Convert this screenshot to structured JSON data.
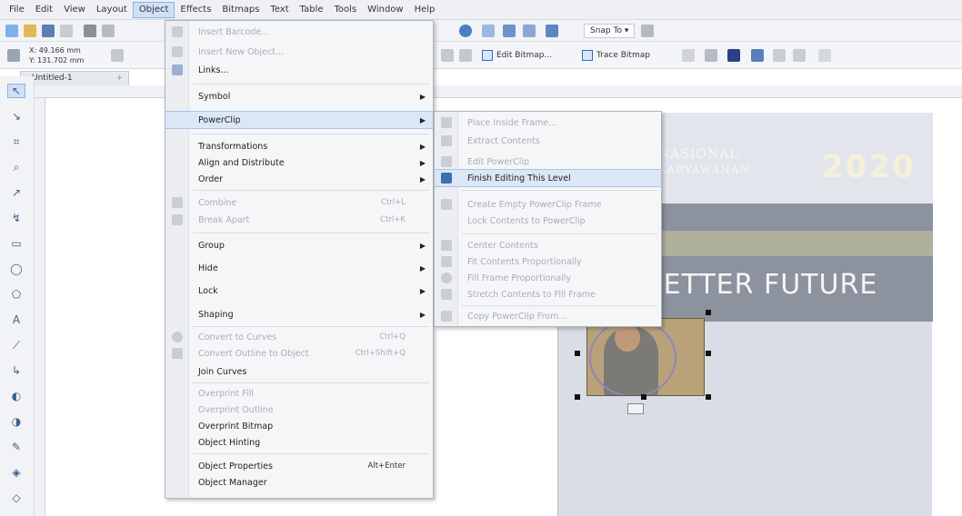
{
  "menubar": {
    "items": [
      "File",
      "Edit",
      "View",
      "Layout",
      "Object",
      "Effects",
      "Bitmaps",
      "Text",
      "Table",
      "Tools",
      "Window",
      "Help"
    ],
    "active": "Object"
  },
  "toolbar": {
    "snap_label": "Snap To ▾"
  },
  "property_bar": {
    "x": "X: 49.166 mm",
    "y": "Y: 131.702 mm",
    "edit_bitmap": "Edit Bitmap...",
    "trace_bitmap": "Trace Bitmap"
  },
  "document": {
    "tab_title": "Untitled-1"
  },
  "object_menu": {
    "items": [
      {
        "label": "Insert Barcode...",
        "disabled": true
      },
      {
        "label": "Insert New Object...",
        "disabled": true
      },
      {
        "label": "Links...",
        "disabled": false
      },
      {
        "label": "Symbol",
        "submenu": true
      },
      {
        "label": "PowerClip",
        "submenu": true,
        "highlighted": true
      },
      {
        "label": "Transformations",
        "submenu": true
      },
      {
        "label": "Align and Distribute",
        "submenu": true
      },
      {
        "label": "Order",
        "submenu": true
      },
      {
        "label": "Combine",
        "shortcut": "Ctrl+L",
        "disabled": true
      },
      {
        "label": "Break Apart",
        "shortcut": "Ctrl+K",
        "disabled": true
      },
      {
        "label": "Group",
        "submenu": true
      },
      {
        "label": "Hide",
        "submenu": true
      },
      {
        "label": "Lock",
        "submenu": true
      },
      {
        "label": "Shaping",
        "submenu": true
      },
      {
        "label": "Convert to Curves",
        "shortcut": "Ctrl+Q",
        "disabled": true
      },
      {
        "label": "Convert Outline to Object",
        "shortcut": "Ctrl+Shift+Q",
        "disabled": true
      },
      {
        "label": "Join Curves"
      },
      {
        "label": "Overprint Fill",
        "disabled": true
      },
      {
        "label": "Overprint Outline",
        "disabled": true
      },
      {
        "label": "Overprint Bitmap"
      },
      {
        "label": "Object Hinting"
      },
      {
        "label": "Object Properties",
        "shortcut": "Alt+Enter"
      },
      {
        "label": "Object Manager"
      }
    ]
  },
  "powerclip_menu": {
    "items": [
      {
        "label": "Place Inside Frame...",
        "disabled": true
      },
      {
        "label": "Extract Contents",
        "disabled": true
      },
      {
        "label": "Edit PowerClip",
        "disabled": true
      },
      {
        "label": "Finish Editing This Level",
        "highlighted": true
      },
      {
        "label": "Create Empty PowerClip Frame",
        "disabled": true
      },
      {
        "label": "Lock Contents to PowerClip",
        "disabled": true
      },
      {
        "label": "Center Contents",
        "disabled": true
      },
      {
        "label": "Fit Contents Proportionally",
        "disabled": true
      },
      {
        "label": "Fill Frame Proportionally",
        "disabled": true
      },
      {
        "label": "Stretch Contents to Fill Frame",
        "disabled": true
      },
      {
        "label": "Copy PowerClip From...",
        "disabled": true
      }
    ]
  },
  "poster": {
    "line1": "NASIONAL",
    "line2": "KARYAWANAN",
    "year": "2020",
    "slogan": "BETTER FUTURE"
  },
  "colors": {
    "highlight": "#dbe7f6",
    "accent": "#2f6dbf",
    "page_bg": "#d9dee6"
  }
}
